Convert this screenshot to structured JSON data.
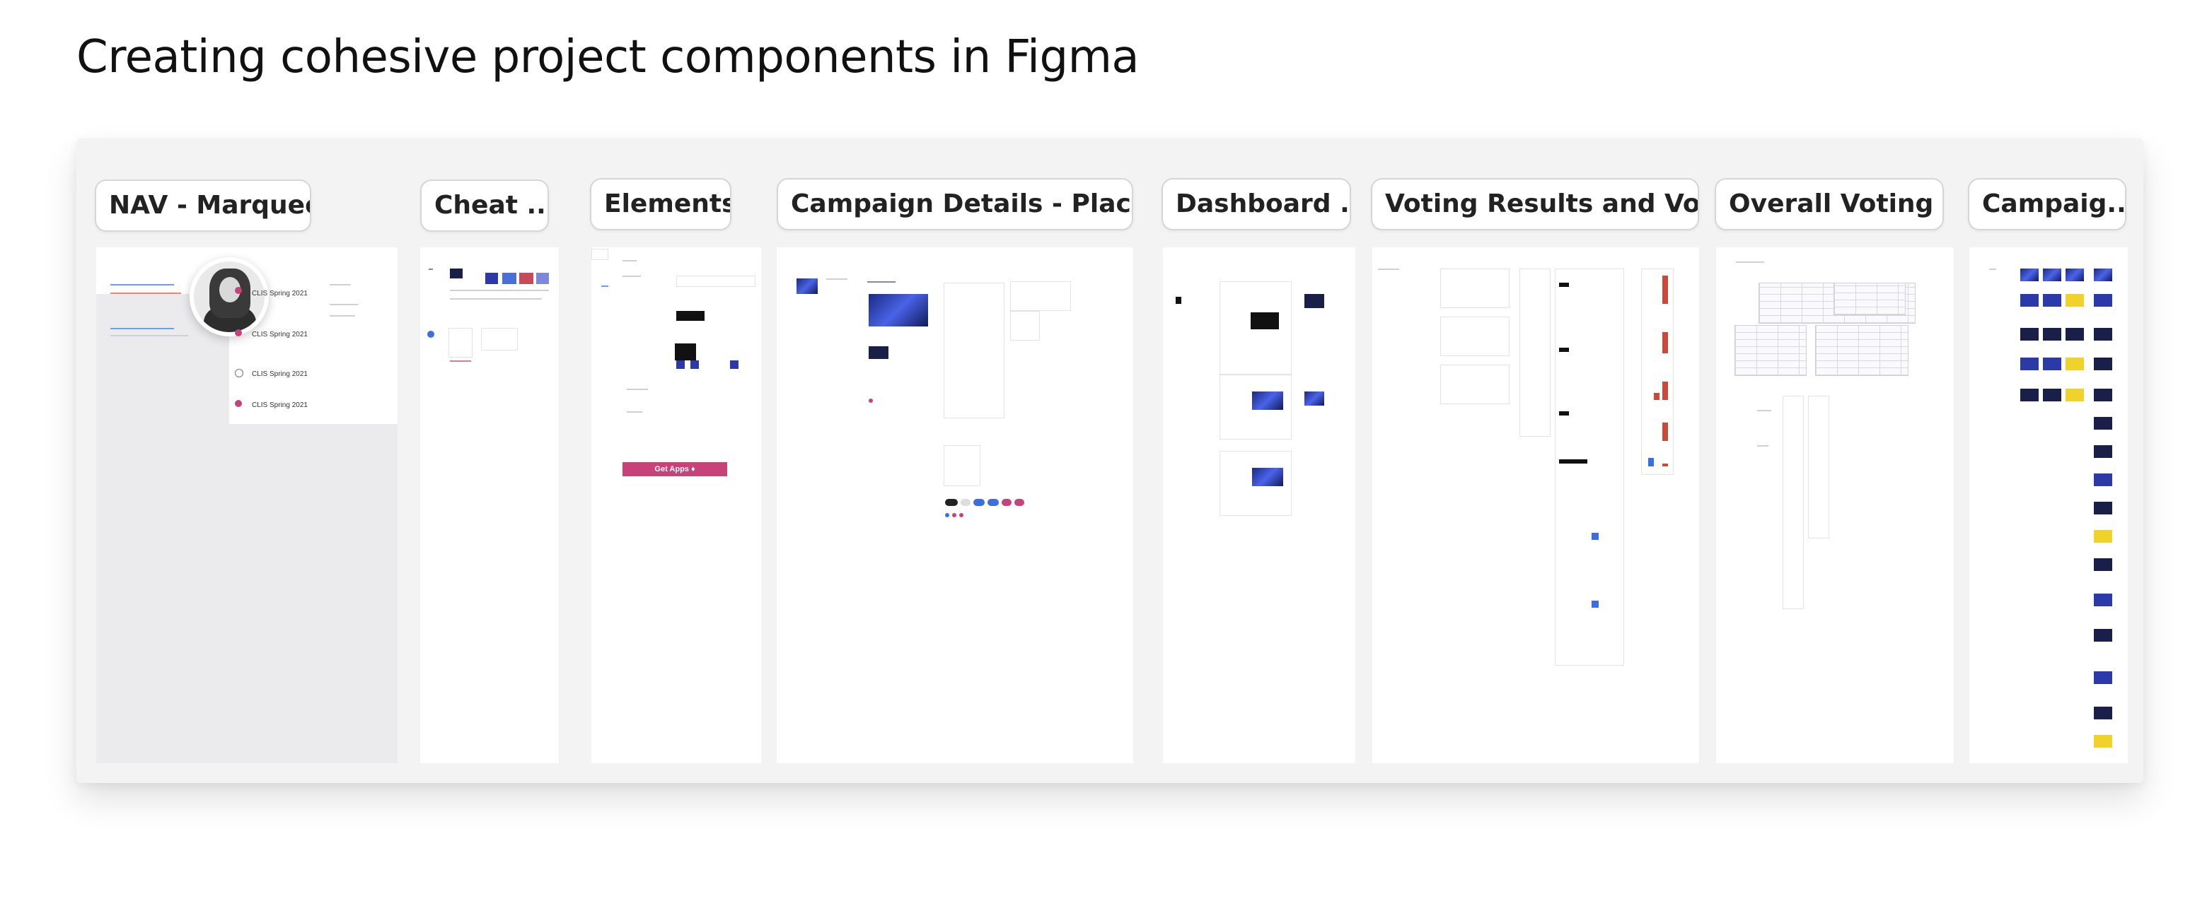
{
  "header": {
    "title": "Creating cohesive project components in Figma"
  },
  "canvas": {
    "frames": [
      {
        "label": "NAV - Marquee"
      },
      {
        "label": "Cheat ..."
      },
      {
        "label": "Elements"
      },
      {
        "label": "Campaign Details - Place..."
      },
      {
        "label": "Dashboard ..."
      },
      {
        "label": "Voting Results and Vot..."
      },
      {
        "label": "Overall Voting ..."
      },
      {
        "label": "Campaig..."
      }
    ],
    "nav_thumb": {
      "item_text": "CLIS Spring 2021"
    },
    "elements_thumb": {
      "button_text": "Get Apps ♦"
    },
    "colors": {
      "accent_pink": "#c8427a",
      "dark_navy": "#1a1f4a",
      "brand_blue": "#3b6fe0",
      "highlight_yellow": "#f1d22b"
    }
  }
}
